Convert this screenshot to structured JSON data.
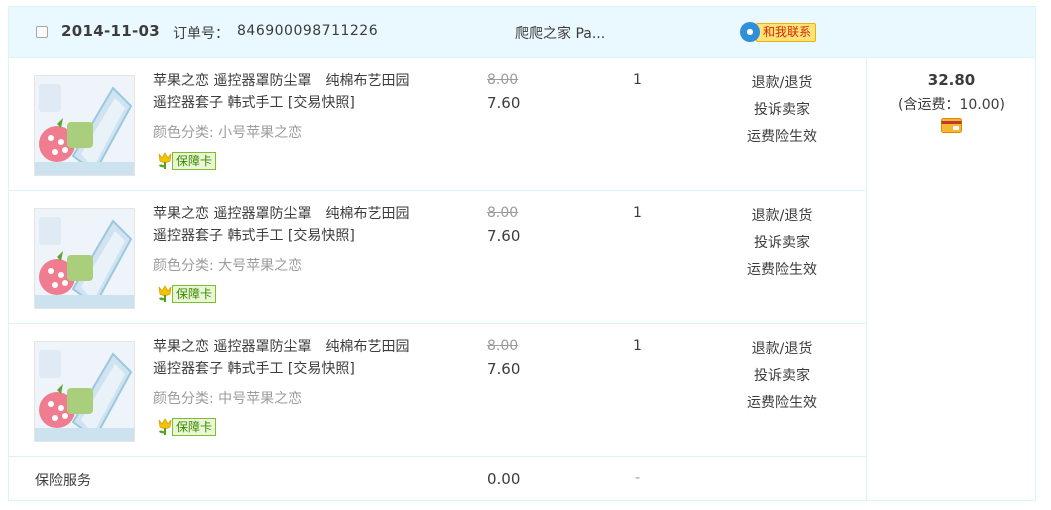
{
  "order": {
    "date": "2014-11-03",
    "order_no_label": "订单号：",
    "order_no": "846900098711226",
    "shop": "爬爬之家 Pa...",
    "contact_label": "和我联系",
    "total": "32.80",
    "postage_text": "(含运费：10.00)"
  },
  "items": [
    {
      "title": "苹果之恋 遥控器罩防尘罩　纯棉布艺田园遥控器套子 韩式手工 [交易快照]",
      "sku": "颜色分类: 小号苹果之恋",
      "card": "保障卡",
      "original_price": "8.00",
      "price": "7.60",
      "qty": "1",
      "actions": [
        "退款/退货",
        "投诉卖家",
        "运费险生效"
      ]
    },
    {
      "title": "苹果之恋 遥控器罩防尘罩　纯棉布艺田园遥控器套子 韩式手工 [交易快照]",
      "sku": "颜色分类: 大号苹果之恋",
      "card": "保障卡",
      "original_price": "8.00",
      "price": "7.60",
      "qty": "1",
      "actions": [
        "退款/退货",
        "投诉卖家",
        "运费险生效"
      ]
    },
    {
      "title": "苹果之恋 遥控器罩防尘罩　纯棉布艺田园遥控器套子 韩式手工 [交易快照]",
      "sku": "颜色分类: 中号苹果之恋",
      "card": "保障卡",
      "original_price": "8.00",
      "price": "7.60",
      "qty": "1",
      "actions": [
        "退款/退货",
        "投诉卖家",
        "运费险生效"
      ]
    }
  ],
  "insurance": {
    "label": "保险服务",
    "amount": "0.00",
    "qty": "-"
  },
  "icons": {
    "checkbox": "checkbox-icon",
    "contact": "chat-bubble-icon",
    "card": "tulip-icon",
    "payment": "payment-card-icon"
  },
  "colors": {
    "header_bg": "#eaf8ff",
    "border": "#daf3ff",
    "contact_badge": "#ffe27a",
    "contact_text": "#d42b00",
    "card_green": "#3a8a00",
    "muted_text": "#9c9c9c"
  }
}
